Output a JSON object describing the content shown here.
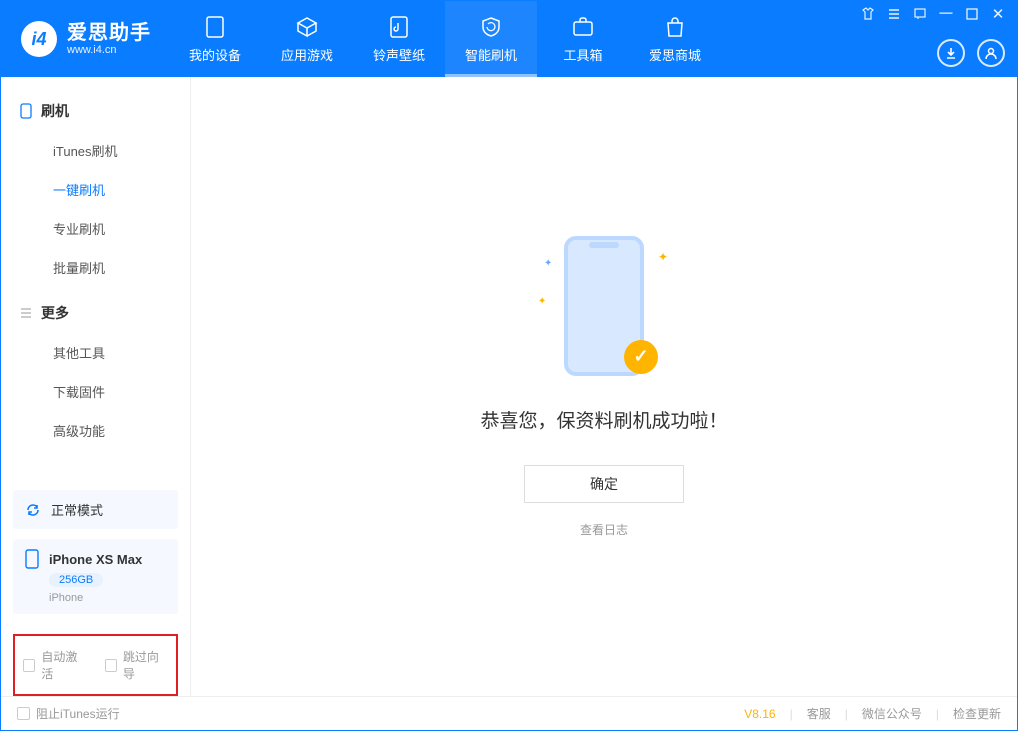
{
  "app": {
    "title": "爱思助手",
    "subtitle": "www.i4.cn"
  },
  "nav": {
    "tabs": [
      {
        "label": "我的设备"
      },
      {
        "label": "应用游戏"
      },
      {
        "label": "铃声壁纸"
      },
      {
        "label": "智能刷机"
      },
      {
        "label": "工具箱"
      },
      {
        "label": "爱思商城"
      }
    ]
  },
  "sidebar": {
    "group1": {
      "title": "刷机",
      "items": [
        "iTunes刷机",
        "一键刷机",
        "专业刷机",
        "批量刷机"
      ]
    },
    "group2": {
      "title": "更多",
      "items": [
        "其他工具",
        "下载固件",
        "高级功能"
      ]
    },
    "status": {
      "label": "正常模式"
    },
    "device": {
      "name": "iPhone XS Max",
      "capacity": "256GB",
      "type": "iPhone"
    },
    "options": {
      "autoActivate": "自动激活",
      "skipGuide": "跳过向导"
    }
  },
  "main": {
    "successText": "恭喜您，保资料刷机成功啦！",
    "okLabel": "确定",
    "logLink": "查看日志"
  },
  "footer": {
    "blockItunes": "阻止iTunes运行",
    "version": "V8.16",
    "links": [
      "客服",
      "微信公众号",
      "检查更新"
    ]
  }
}
